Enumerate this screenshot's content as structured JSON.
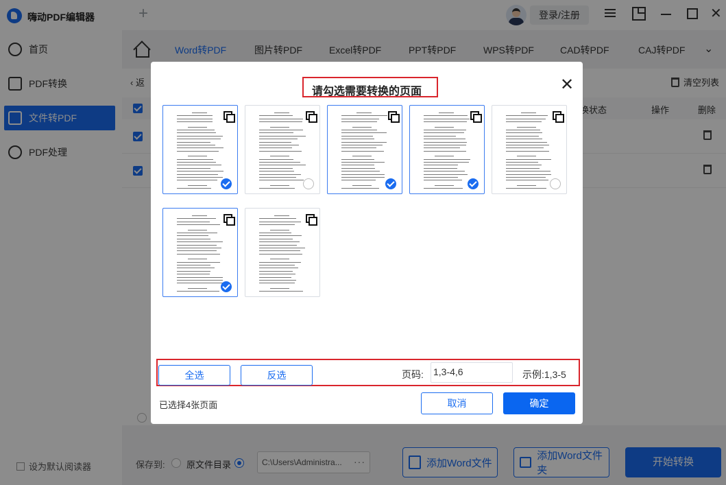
{
  "app": {
    "title": "嗨动PDF编辑器",
    "new_tab_glyph": "+",
    "login_label": "登录/注册"
  },
  "sidebar": {
    "items": [
      {
        "label": "首页",
        "icon": "home-circle-icon",
        "active": false
      },
      {
        "label": "PDF转换",
        "icon": "pdf-convert-icon",
        "active": false
      },
      {
        "label": "文件转PDF",
        "icon": "file-to-pdf-icon",
        "active": true
      },
      {
        "label": "PDF处理",
        "icon": "pdf-process-icon",
        "active": false
      }
    ],
    "default_reader_label": "设为默认阅读器"
  },
  "tabs": [
    "Word转PDF",
    "图片转PDF",
    "Excel转PDF",
    "PPT转PDF",
    "WPS转PDF",
    "CAD转PDF",
    "CAJ转PDF"
  ],
  "active_tab": "Word转PDF",
  "list": {
    "back_label": "返",
    "clear_label": "清空列表",
    "headers": {
      "status": "换状态",
      "operation": "操作",
      "delete": "删除"
    }
  },
  "bottom": {
    "save_to_label": "保存到:",
    "original_dir_label": "原文件目录",
    "path_value": "C:\\Users\\Administra...",
    "path_more": "···",
    "add_word_file_label": "添加Word文件",
    "add_word_folder_label": "添加Word文件夹",
    "start_label": "开始转换"
  },
  "dialog": {
    "title": "请勾选需要转换的页面",
    "close_glyph": "✕",
    "pages": [
      {
        "index": 1,
        "selected": true
      },
      {
        "index": 2,
        "selected": false
      },
      {
        "index": 3,
        "selected": true
      },
      {
        "index": 4,
        "selected": true
      },
      {
        "index": 5,
        "selected": false
      },
      {
        "index": 6,
        "selected": true
      },
      {
        "index": 7,
        "selected": null
      }
    ],
    "select_all_label": "全选",
    "invert_label": "反选",
    "page_num_label": "页码:",
    "page_num_value": "1,3-4,6",
    "example_label": "示例:1,3-5",
    "selected_count_label": "已选择4张页面",
    "cancel_label": "取消",
    "ok_label": "确定"
  },
  "colors": {
    "accent": "#1a6cf0",
    "highlight_box": "#d9252c",
    "overlay": "rgba(0,0,0,0.45)"
  }
}
